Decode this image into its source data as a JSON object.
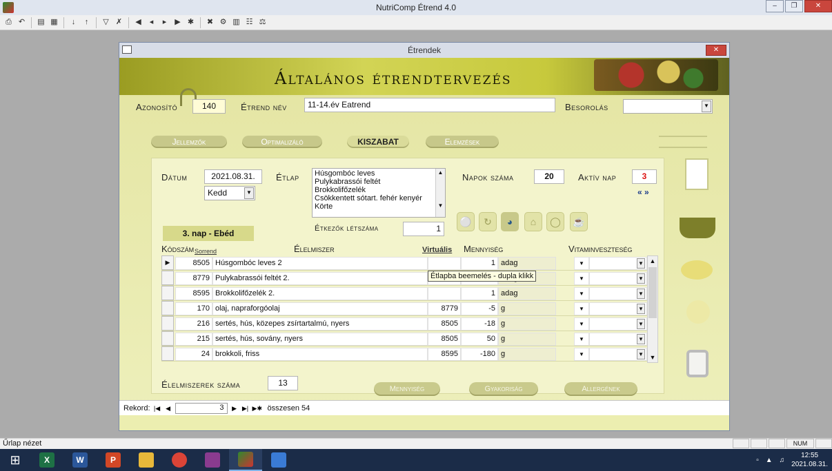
{
  "app": {
    "title": "NutriComp Étrend 4.0"
  },
  "child_window": {
    "title": "Étrendek"
  },
  "header": {
    "title": "Általános étrendtervezés"
  },
  "form": {
    "azonosito_label": "Azonosító",
    "azonosito_value": "140",
    "etrend_nev_label": "Étrend név",
    "etrend_nev_value": "11-14.év Eatrend",
    "besorolas_label": "Besorolás",
    "besorolas_value": ""
  },
  "tabs": [
    {
      "label": "Jellemzők",
      "active": false
    },
    {
      "label": "Optimalizáló",
      "active": false
    },
    {
      "label": "KISZABAT",
      "active": true
    },
    {
      "label": "Elemzések",
      "active": false
    }
  ],
  "panel": {
    "datum_label": "Dátum",
    "datum_value": "2021.08.31.",
    "day_value": "Kedd",
    "etlap_label": "Étlap",
    "etlap_items": [
      "Húsgombóc leves",
      "Pulykabrassói feltét",
      "Brokkolifőzelék",
      "Csökkentett sótart. fehér kenyér",
      "Körte"
    ],
    "napok_label": "Napok száma",
    "napok_value": "20",
    "aktiv_label": "Aktív nap",
    "aktiv_value": "3",
    "day_nav": "« »",
    "meal_label": "3. nap - Ebéd",
    "etkezok_label": "Étkezők létszáma",
    "etkezok_value": "1"
  },
  "grid": {
    "headers": {
      "kodszam": "Kódszám",
      "sorrend": "Sorrend",
      "elelmiszer": "Élelmiszer",
      "virtualis": "Virtuális",
      "mennyiseg": "Mennyiség",
      "vitamin": "Vitaminveszteség"
    },
    "rows": [
      {
        "code": "8505",
        "name": "Húsgombóc leves 2",
        "virt": "",
        "qty": "1",
        "unit": "adag"
      },
      {
        "code": "8779",
        "name": "Pulykabrassói feltét 2.",
        "virt": "",
        "qty": "1",
        "unit": "adag"
      },
      {
        "code": "8595",
        "name": "Brokkolifőzelék 2.",
        "virt": "",
        "qty": "1",
        "unit": "adag"
      },
      {
        "code": "170",
        "name": "olaj, napraforgóolaj",
        "virt": "8779",
        "qty": "-5",
        "unit": "g"
      },
      {
        "code": "216",
        "name": "sertés, hús, közepes zsírtartalmú, nyers",
        "virt": "8505",
        "qty": "-18",
        "unit": "g"
      },
      {
        "code": "215",
        "name": "sertés, hús, sovány, nyers",
        "virt": "8505",
        "qty": "50",
        "unit": "g"
      },
      {
        "code": "24",
        "name": "brokkoli, friss",
        "virt": "8595",
        "qty": "-180",
        "unit": "g"
      }
    ],
    "tooltip": "Étlapba beemelés - dupla klikk"
  },
  "footer": {
    "elelmiszerek_label": "Élelmiszerek száma",
    "elelmiszerek_value": "13",
    "buttons": [
      "Mennyiség",
      "Gyakoriság",
      "Allergének"
    ]
  },
  "record_nav": {
    "label": "Rekord:",
    "current": "3",
    "total_text": "összesen 54"
  },
  "statusbar": {
    "text": "Űrlap nézet",
    "num": "NUM"
  },
  "taskbar": {
    "time": "12:55",
    "date": "2021.08.31."
  }
}
